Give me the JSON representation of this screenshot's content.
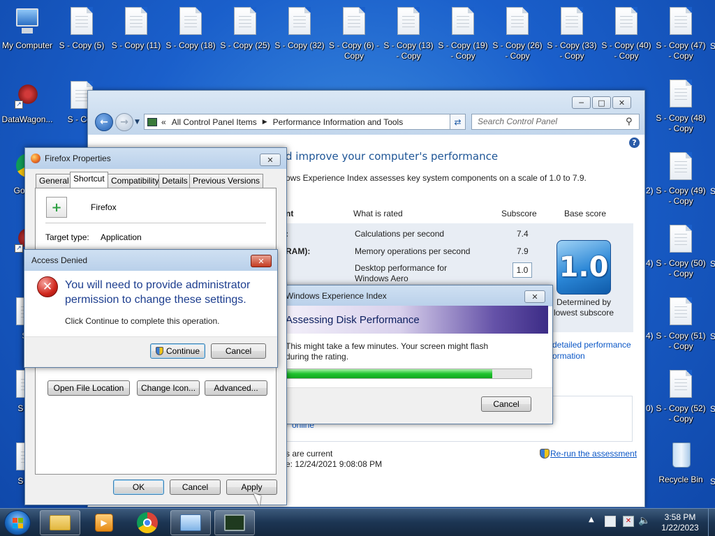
{
  "desktop": {
    "icons_row1": [
      {
        "label": "My Computer",
        "type": "computer"
      },
      {
        "label": "S - Copy (5)",
        "type": "doc"
      },
      {
        "label": "S - Copy (11)",
        "type": "doc"
      },
      {
        "label": "S - Copy (18)",
        "type": "doc"
      },
      {
        "label": "S - Copy (25)",
        "type": "doc"
      },
      {
        "label": "S - Copy (32)",
        "type": "doc"
      },
      {
        "label": "S - Copy (6) - Copy",
        "type": "doc"
      },
      {
        "label": "S - Copy (13) - Copy",
        "type": "doc"
      },
      {
        "label": "S - Copy (19) - Copy",
        "type": "doc"
      },
      {
        "label": "S - Copy (26) - Copy",
        "type": "doc"
      },
      {
        "label": "S - Copy (33) - Copy",
        "type": "doc"
      },
      {
        "label": "S - Copy (40) - Copy",
        "type": "doc"
      },
      {
        "label": "S - Copy (47) - Copy",
        "type": "doc"
      }
    ],
    "icons_left": [
      {
        "label": "DataWagon...",
        "type": "app"
      },
      {
        "label": "S - Cop",
        "type": "doc"
      },
      {
        "label": "Go Chr",
        "type": "chrome"
      },
      {
        "label": "Fi",
        "type": "app"
      },
      {
        "label": "S -",
        "type": "doc"
      },
      {
        "label": "S - C",
        "type": "doc"
      },
      {
        "label": "S - C",
        "type": "doc"
      }
    ],
    "icons_right": [
      {
        "label": "S - Copy (48) - Copy"
      },
      {
        "label": "S - Copy (49) - Copy"
      },
      {
        "label": "S - Copy (50) - Copy"
      },
      {
        "label": "S - Copy (51) - Copy"
      },
      {
        "label": "S - Copy (52) - Copy"
      },
      {
        "label": "Recycle Bin"
      }
    ],
    "right_edge_fragments": [
      "S",
      "S",
      "S",
      "S",
      "S",
      "S"
    ],
    "mid_fragments": [
      "2)",
      "4)",
      "4)",
      "0)"
    ]
  },
  "control_panel": {
    "breadcrumb": [
      "All Control Panel Items",
      "Performance Information and Tools"
    ],
    "breadcrumb_prefix": "«",
    "search_placeholder": "Search Control Panel",
    "heading": "d improve your computer's performance",
    "intro": "ows Experience Index assesses key system components on a scale of 1.0 to 7.9.",
    "table": {
      "col_component": "nt",
      "col_what": "What is rated",
      "col_subscore": "Subscore",
      "col_base": "Base score",
      "rows": [
        {
          "component": ":",
          "what": "Calculations per second",
          "subscore": "7.4"
        },
        {
          "component": "RAM):",
          "what": "Memory operations per second",
          "subscore": "7.9"
        },
        {
          "component": "",
          "what": "Desktop performance for Windows Aero",
          "subscore": "1.0"
        }
      ],
      "base_score": "1.0",
      "base_caption": "Determined by lowest subscore"
    },
    "detail_link": "detailed performance",
    "detail_link_2": "ormation",
    "online_fragment": "online",
    "status_current": "s are current",
    "last_update": "e: 12/24/2021 9:08:08 PM",
    "rerun_link": "Re-run the assessment"
  },
  "wei_dialog": {
    "title": "Windows Experience Index",
    "banner": "Assessing Disk Performance",
    "message": "This might take a few minutes. Your screen might flash during the rating.",
    "message_line1": "This might take a few minutes. Your screen might flash",
    "message_line2": "during the rating.",
    "progress_fraction": 0.84,
    "cancel_label": "Cancel"
  },
  "firefox_properties": {
    "title": "Firefox Properties",
    "tabs": [
      "General",
      "Shortcut",
      "Compatibility",
      "Details",
      "Previous Versions"
    ],
    "active_tab": "Shortcut",
    "app_name": "Firefox",
    "target_type_label": "Target type:",
    "target_type_value": "Application",
    "open_location_label": "Open File Location",
    "change_icon_label": "Change Icon...",
    "advanced_label": "Advanced...",
    "ok_label": "OK",
    "cancel_label": "Cancel",
    "apply_label": "Apply"
  },
  "access_denied": {
    "title": "Access Denied",
    "message": "You will need to provide administrator permission to change these settings.",
    "message_line1": "You will need to provide administrator",
    "message_line2": "permission to change these settings.",
    "sub_message": "Click Continue to complete this operation.",
    "continue_label": "Continue",
    "cancel_label": "Cancel"
  },
  "taskbar": {
    "time": "3:58 PM",
    "date": "1/22/2023"
  }
}
